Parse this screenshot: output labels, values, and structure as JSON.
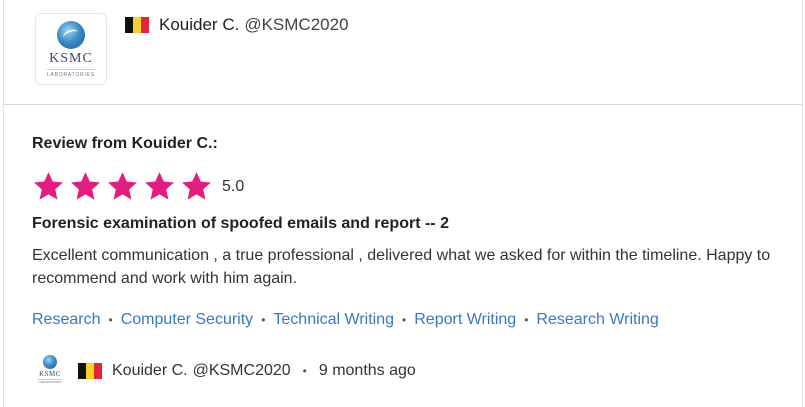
{
  "company": {
    "logo_text": "KSMC",
    "logo_subtext": "LABORATORIES",
    "flag": "belgium-flag",
    "name": "Kouider C.",
    "handle": "@KSMC2020"
  },
  "review": {
    "heading": "Review from Kouider C.:",
    "rating": 5.0,
    "rating_label": "5.0",
    "star_color": "#e31d7d",
    "job_title": "Forensic examination of spoofed emails and report -- 2",
    "comment": "Excellent communication , a true professional , delivered what we asked for within the timeline. Happy to recommend and work with him again.",
    "tags": [
      "Research",
      "Computer Security",
      "Technical Writing",
      "Report Writing",
      "Research Writing"
    ],
    "tag_color": "#3a78c3"
  },
  "footer": {
    "name": "Kouider C.",
    "handle": "@KSMC2020",
    "time_ago": "9 months ago"
  }
}
